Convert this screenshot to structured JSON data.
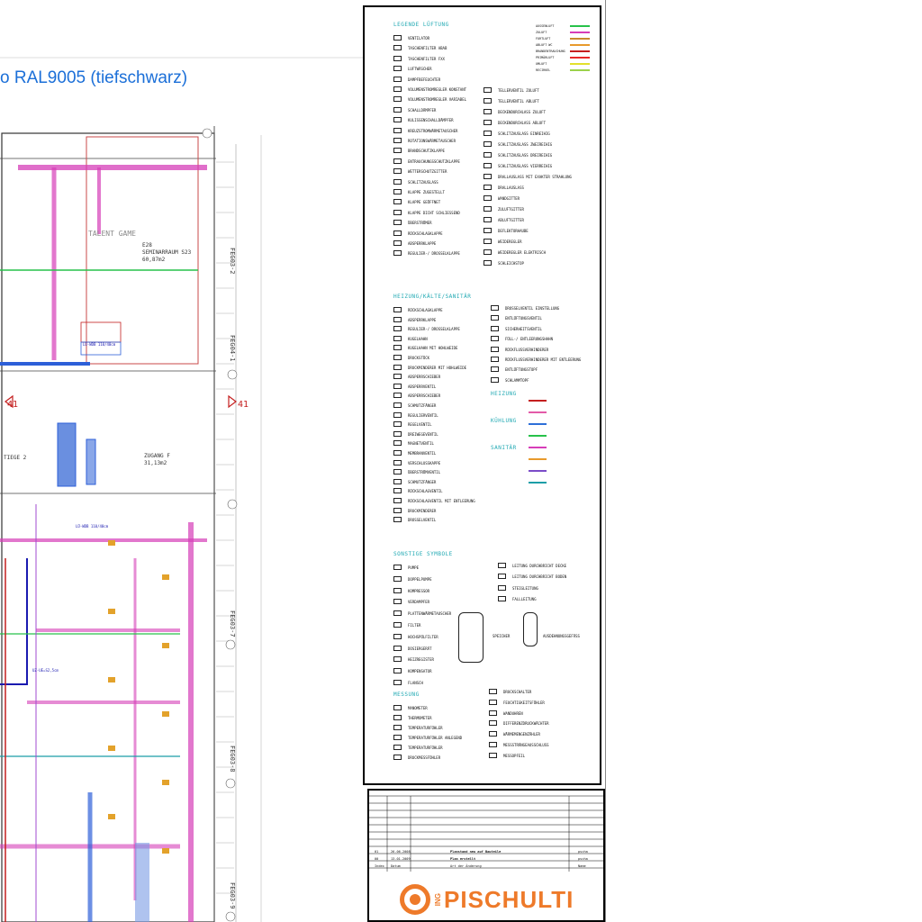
{
  "plan": {
    "headline": "o RAL9005 (tiefschwarz)",
    "room_labels": [
      {
        "text": "E28",
        "tag": "room-id"
      },
      {
        "text": "SEMINARRAUM S23",
        "tag": "room-name"
      },
      {
        "text": "60,87m2",
        "tag": "room-area"
      },
      {
        "text": "TALENT GAME",
        "tag": "zone"
      },
      {
        "text": "ZUGANG F",
        "tag": "room-name-2"
      },
      {
        "text": "31,13m2",
        "tag": "room-area-2"
      },
      {
        "text": "FEG04-1",
        "tag": "axis"
      },
      {
        "text": "FEG03-2",
        "tag": "axis-2"
      },
      {
        "text": "FEG03-7",
        "tag": "axis-3"
      },
      {
        "text": "FEG03-8",
        "tag": "axis-4"
      },
      {
        "text": "FEG03-9",
        "tag": "axis-5"
      },
      {
        "text": "41",
        "tag": "section-mark"
      },
      {
        "text": "41",
        "tag": "section-mark-2"
      },
      {
        "text": "TIEGE 2",
        "tag": "room-name-3"
      },
      {
        "text": "LÜ-WDB 110/40cm",
        "tag": "duct"
      },
      {
        "text": "LÜ-WDB 110/40cm",
        "tag": "duct-2"
      },
      {
        "text": "UZ-UE=S2,5cm",
        "tag": "duct-3"
      }
    ]
  },
  "legend": {
    "sections": [
      {
        "title": "LEGENDE LÜFTUNG",
        "rows": [
          {
            "label": "VENTILATOR"
          },
          {
            "label": "TASCHENFILTER ABAB"
          },
          {
            "label": "TASCHENFILTER FXX"
          },
          {
            "label": "LUFTWÄSCHER"
          },
          {
            "label": "DAMPFBEFEUCHTER"
          },
          {
            "label": "VOLUMENSTROMREGLER KONSTANT"
          },
          {
            "label": "VOLUMENSTROMREGLER VARIABEL"
          },
          {
            "label": "SCHALLDÄMPFER"
          },
          {
            "label": "KULISSENSCHALLDÄMPFER"
          },
          {
            "label": "KREUZSTROMWÄRMETAUSCHER"
          },
          {
            "label": "ROTATIONSWÄRMETAUSCHER"
          },
          {
            "label": "BRANDSCHUTZKLAPPE"
          },
          {
            "label": "ENTRAUCHUNGSSCHUTZKLAPPE"
          },
          {
            "label": "WETTERSCHUTZGITTER"
          },
          {
            "label": "SCHLITZAUSLASS"
          },
          {
            "label": "KLAPPE ZUGESTELLT"
          },
          {
            "label": "KLAPPE GEÖFFNET"
          },
          {
            "label": "KLAPPE DICHT SCHLIESSEND"
          },
          {
            "label": "ÜBERSTRÖMER"
          },
          {
            "label": "RÜCKSCHLAGKLAPPE"
          },
          {
            "label": "ABSPERRKLAPPE"
          },
          {
            "label": "REGULIER-/ DROSSELKLAPPE"
          }
        ]
      },
      {
        "title": "HEIZUNG/KÄLTE/SANITÄR",
        "rows": [
          {
            "label": "RÜCKSCHLAGKLAPPE"
          },
          {
            "label": "ABSPERRKLAPPE"
          },
          {
            "label": "REGULIER-/ DROSSELKLAPPE"
          },
          {
            "label": "KUGELHAHN"
          },
          {
            "label": "KUGELHAHN MIT HOHLWEIDE"
          },
          {
            "label": "DRUCKSTÜCK"
          },
          {
            "label": "DRUCKMINDERER MIT HOHLWEIDE"
          },
          {
            "label": "ABSPERRSCHIEBER"
          },
          {
            "label": "ABSPERRVENTIL"
          },
          {
            "label": "ABSPERRSCHIEBER"
          },
          {
            "label": "SCHMUTZFÄNGER"
          },
          {
            "label": "REGULIERVENTIL"
          },
          {
            "label": "REGELVENTIL"
          },
          {
            "label": "DREIWEGEVENTIL"
          },
          {
            "label": "MAGNETVENTIL"
          },
          {
            "label": "MEMBRANVENTIL"
          },
          {
            "label": "VERSCHLUSSKAPPE"
          },
          {
            "label": "ÜBERSTRÖMVENTIL"
          },
          {
            "label": "SCHMUTZFÄNGER"
          },
          {
            "label": "RÜCKSCHLAGVENTIL"
          },
          {
            "label": "RÜCKSCHLAGVENTIL MIT ENTLEERUNG"
          },
          {
            "label": "DRUCKMINDERER"
          },
          {
            "label": "DROSSELVENTIL"
          }
        ]
      },
      {
        "title": "SONSTIGE SYMBOLE",
        "rows": [
          {
            "label": "PUMPE"
          },
          {
            "label": "DOPPELPUMPE"
          },
          {
            "label": "KOMPRESSOR"
          },
          {
            "label": "VERDAMPFER"
          },
          {
            "label": "PLATTENWÄRMETAUSCHER"
          },
          {
            "label": "FILTER"
          },
          {
            "label": "HOCHSPÜLFILTER"
          },
          {
            "label": "DOSIERGERÄT"
          },
          {
            "label": "HEIZREGISTER"
          },
          {
            "label": "KOMPENSATOR"
          },
          {
            "label": "FLANSCH"
          }
        ]
      },
      {
        "title": "MESSUNG",
        "rows": [
          {
            "label": "MANOMETER"
          },
          {
            "label": "THERMOMETER"
          },
          {
            "label": "TEMPERATURFÜHLER"
          },
          {
            "label": "TEMPERATURFÜHLER ANLEGEND"
          },
          {
            "label": "TEMPERATURFÜHLER"
          },
          {
            "label": "DRUCKMESSFÜHLER"
          }
        ]
      }
    ],
    "media_lines": [
      {
        "label": "AUSSENLUFT",
        "color": "#27c24a"
      },
      {
        "label": "ZULUFT",
        "color": "#d63db8"
      },
      {
        "label": "FORTLUFT",
        "color": "#c98a2e"
      },
      {
        "label": "ABLUFT WC",
        "color": "#e89a2c"
      },
      {
        "label": "BRANDENTRAUCHUNG",
        "color": "#c41f1f"
      },
      {
        "label": "PRIMÄRLUFT",
        "color": "#e82828"
      },
      {
        "label": "UMLUFT",
        "color": "#e3e02b"
      },
      {
        "label": "RECIRKEL",
        "color": "#9bd14b"
      }
    ],
    "right_col": [
      {
        "label": "TELLERVENTIL ZULUFT"
      },
      {
        "label": "TELLERVENTIL ABLUFT"
      },
      {
        "label": "DECKENDURCHLASS ZULUFT"
      },
      {
        "label": "DECKENDURCHLASS ABLUFT"
      },
      {
        "label": "SCHLITZAUSLASS EINREIHIG"
      },
      {
        "label": "SCHLITZAUSLASS ZWEIREIHIG"
      },
      {
        "label": "SCHLITZAUSLASS DREIREIHIG"
      },
      {
        "label": "SCHLITZAUSLASS VIERREIHIG"
      },
      {
        "label": "DRALLAUSLASS MIT EXAKTER STRAHLUNG"
      },
      {
        "label": "DRALLAUSLASS"
      },
      {
        "label": "WANDGITTER"
      },
      {
        "label": "ZULUFTGITTER"
      },
      {
        "label": "ABLUFTGITTER"
      },
      {
        "label": "DEFLEKTORHAUBE"
      },
      {
        "label": "WEIDEREGLER"
      },
      {
        "label": "WEIDEREGLER ELEKTRISCH"
      },
      {
        "label": "SCHLEICHSTOP"
      }
    ],
    "right_col_2": [
      {
        "label": "DROSSELVENTIL EINSTELLUNG"
      },
      {
        "label": "ENTLÜFTUNGSVENTIL"
      },
      {
        "label": "SICHERHEITSVENTIL"
      },
      {
        "label": "FÜLL-/ ENTLEERUNGSHAHN"
      },
      {
        "label": "RÜCKFLUSSVERHINDERER"
      },
      {
        "label": "RÜCKFLUSSVERHINDERER MIT ENTLEERUNG"
      },
      {
        "label": "ENTLÜFTUNGSTOPF"
      },
      {
        "label": "SCHLAMMTOPF"
      }
    ],
    "subheads": [
      "HEIZUNG",
      "KÜHLUNG",
      "SANITÄR"
    ],
    "pipe_colors": [
      "#c41f1f",
      "#e35aa8",
      "#2d6fd8",
      "#27c24a",
      "#d63db8",
      "#e89a2c",
      "#7b4cc8",
      "#1b9ea8"
    ],
    "vessel_labels": [
      "SPEICHER",
      "AUSDEHNUNGSGEFÄSS"
    ],
    "right_col_3": [
      {
        "label": "LEITUNG DURCHBRICHT DECKE"
      },
      {
        "label": "LEITUNG DURCHBRICHT BODEN"
      },
      {
        "label": "STEIGLEITUNG"
      },
      {
        "label": "FALLLEITUNG"
      }
    ],
    "right_col_4": [
      {
        "label": "DRUCKSCHALTER"
      },
      {
        "label": "FEUCHTIGKEITSFÜHLER"
      },
      {
        "label": "WANDUHREN"
      },
      {
        "label": "DIFFERENZDRUCKWÄCHTER"
      },
      {
        "label": "WÄRMEMENGENZÄHLER"
      },
      {
        "label": "MESSSTRÄNGEAUSSCHLUSS"
      },
      {
        "label": "MESSOPFEIL"
      }
    ]
  },
  "titleblock": {
    "revisions": [
      {
        "idx": "01",
        "date": "26.06.2008",
        "text": "Planstand neu auf Bauteile",
        "sign": "pscha"
      },
      {
        "idx": "00",
        "date": "13.01.2009",
        "text": "Plan erstellt",
        "sign": "pscha"
      },
      {
        "idx": "Index",
        "date": "Datum",
        "text": "Art der Änderung",
        "sign": "Name"
      }
    ],
    "logo_prefix": "ING",
    "logo_name": "PISCHULTI",
    "logo_color": "#ee7a2a"
  }
}
